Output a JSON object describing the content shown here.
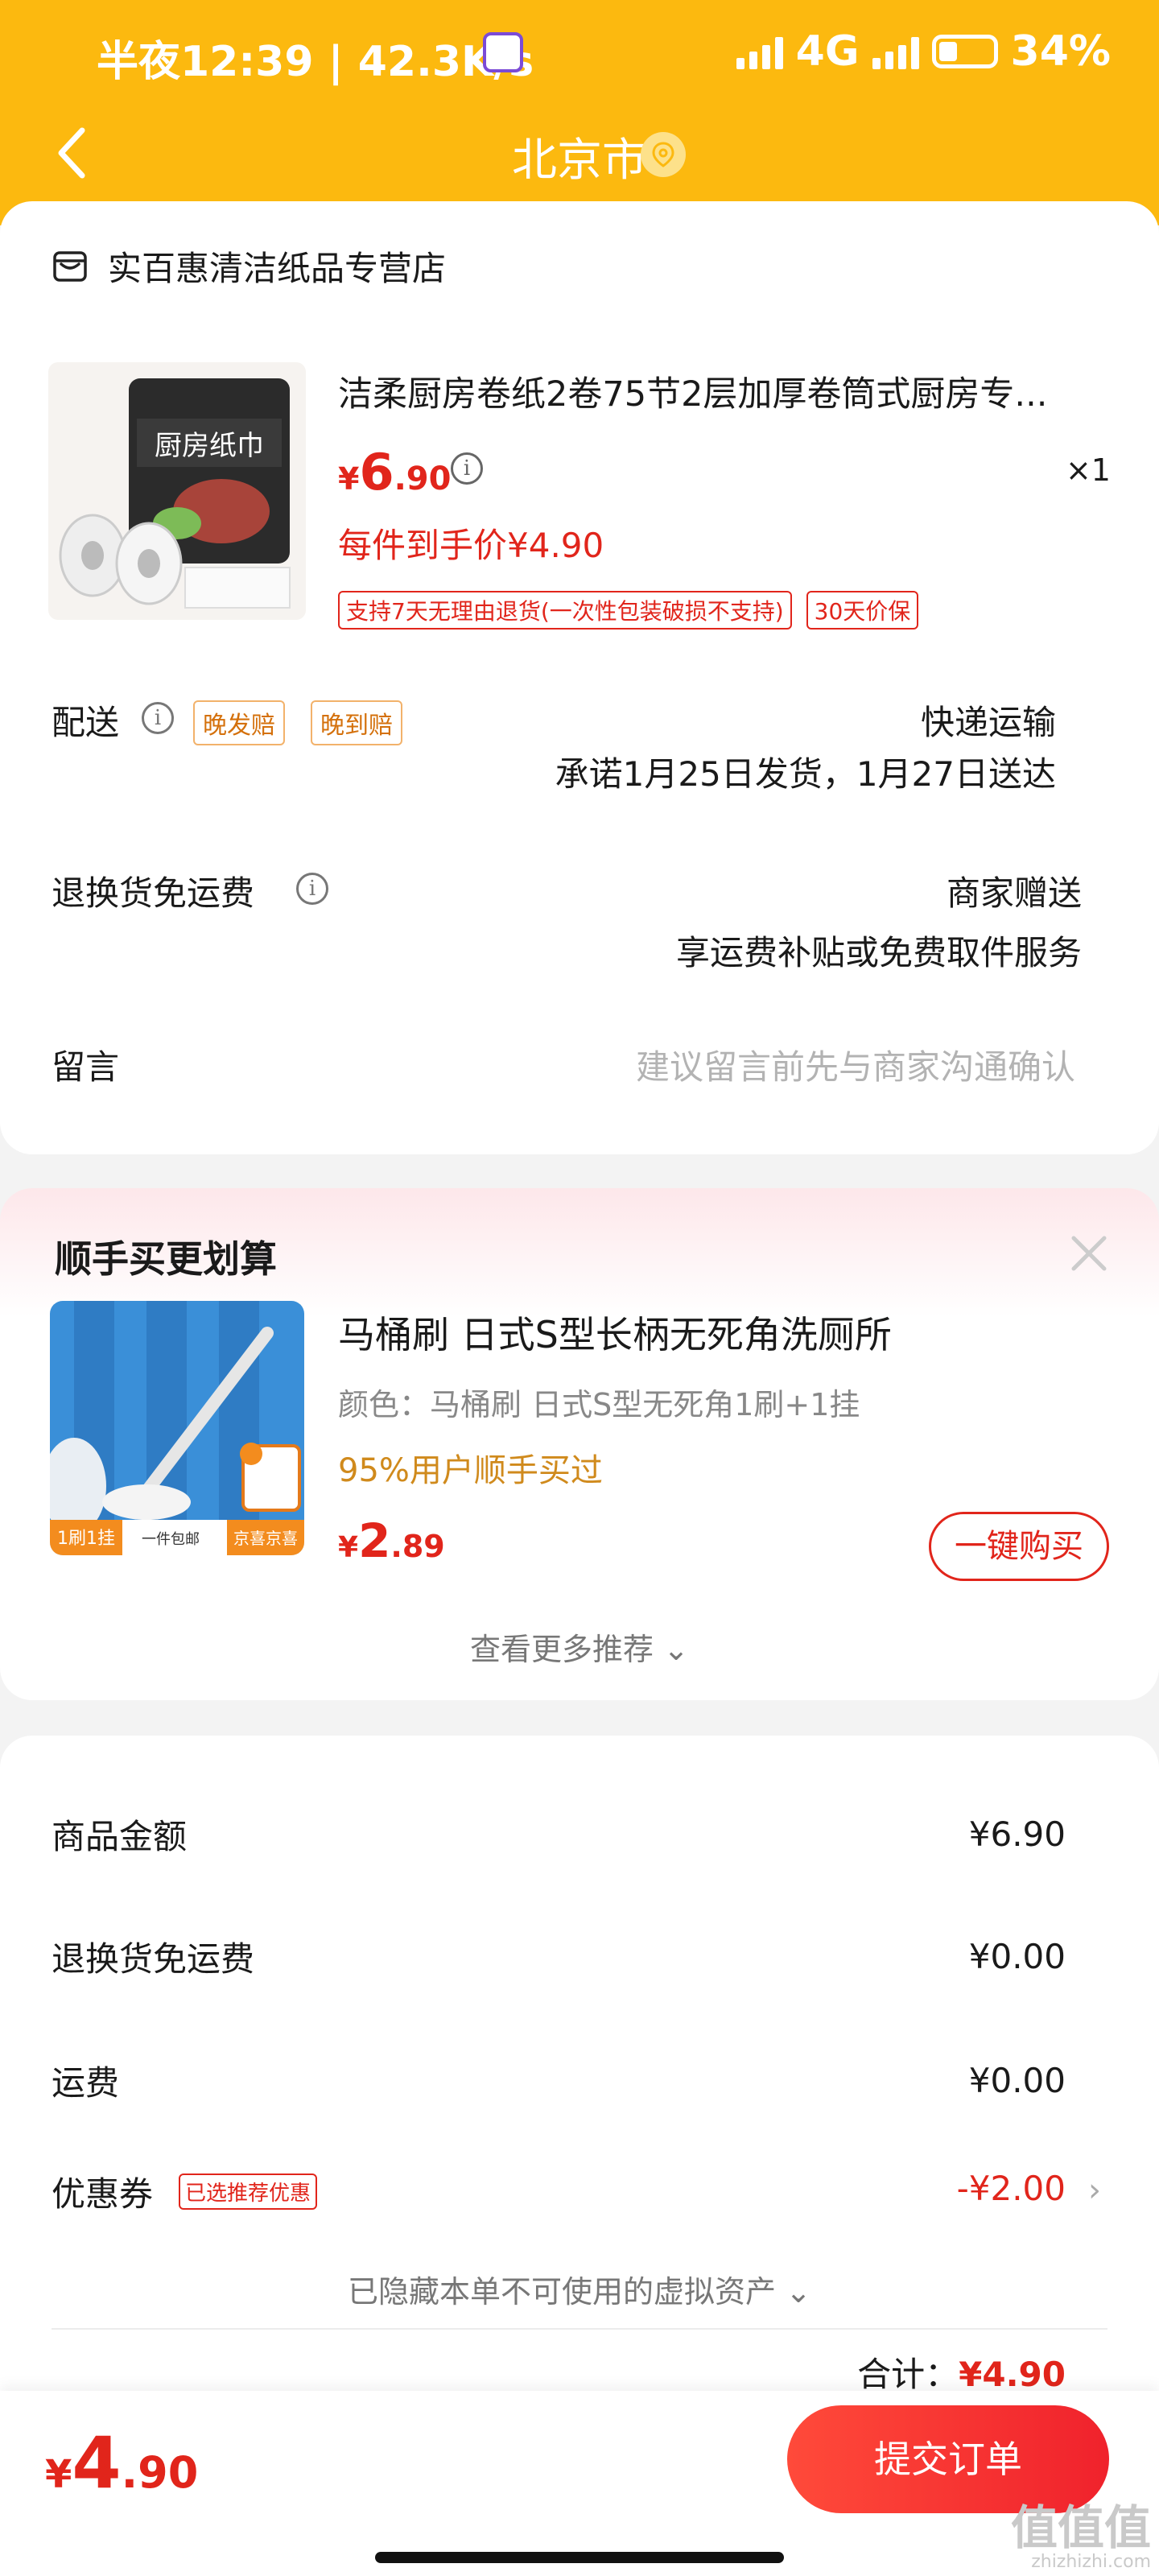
{
  "status_bar": {
    "time": "半夜12:39 | 42.3K/s",
    "network": "4G",
    "battery": "34%"
  },
  "header": {
    "title": "北京市"
  },
  "store": {
    "name": "实百惠清洁纸品专营店"
  },
  "product": {
    "title": "洁柔厨房卷纸2卷75节2层加厚卷筒式厨房专...",
    "price_currency": "¥",
    "price_int": "6",
    "price_dec": ".90",
    "quantity": "×1",
    "final_price": "每件到手价¥4.90",
    "image_text": "厨房纸巾",
    "tags": [
      "支持7天无理由退货(一次性包装破损不支持)",
      "30天价保"
    ]
  },
  "delivery": {
    "label": "配送",
    "tags": [
      "晚发赔",
      "晚到赔"
    ],
    "method": "快递运输",
    "promise": "承诺1月25日发货，1月27日送达"
  },
  "return_shipping": {
    "label": "退换货免运费",
    "value": "商家赠送",
    "desc": "享运费补贴或免费取件服务"
  },
  "message": {
    "label": "留言",
    "placeholder": "建议留言前先与商家沟通确认"
  },
  "recommend": {
    "title": "顺手买更划算",
    "name": "马桶刷 日式S型长柄无死角洗厕所",
    "color": "颜色：马桶刷 日式S型无死角1刷+1挂",
    "bought": "95%用户顺手买过",
    "price_currency": "¥",
    "price_int": "2",
    "price_dec": ".89",
    "buy_label": "一键购买",
    "more_label": "查看更多推荐 ⌄",
    "img_badge_left": "1刷1挂",
    "img_badge_mid": "一件包邮",
    "img_badge_right": "京喜京喜"
  },
  "summary": {
    "items": [
      {
        "label": "商品金额",
        "value": "¥6.90"
      },
      {
        "label": "退换货免运费",
        "value": "¥0.00"
      },
      {
        "label": "运费",
        "value": "¥0.00"
      }
    ],
    "coupon_label": "优惠券",
    "coupon_tag": "已选推荐优惠",
    "coupon_value": "-¥2.00",
    "hidden_assets": "已隐藏本单不可使用的虚拟资产 ⌄",
    "total_label": "合计：",
    "total_value": "¥4.90"
  },
  "bottom_bar": {
    "price_currency": "¥",
    "price_int": "4",
    "price_dec": ".90",
    "submit_label": "提交订单"
  },
  "watermark": {
    "big": "值值值",
    "small": "zhizhizhi.com"
  },
  "colors": {
    "header": "#fcb90f",
    "accent_red": "#e1251b",
    "orange_text": "#d08a1c"
  }
}
